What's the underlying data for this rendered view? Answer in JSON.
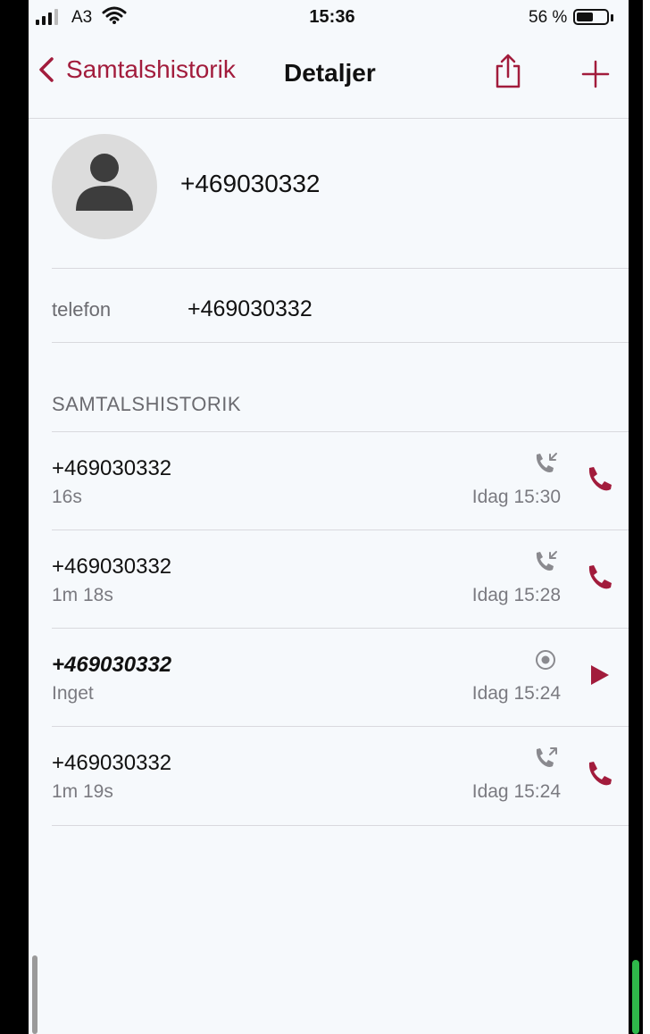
{
  "status_bar": {
    "carrier": "A3",
    "time": "15:36",
    "battery_percent": "56 %",
    "battery_level": 0.56,
    "signal_bars": 3
  },
  "nav": {
    "back_label": "Samtalshistorik",
    "title": "Detaljer",
    "share_icon": "share-icon",
    "add_icon": "plus-icon",
    "accent_color": "#a21c3c"
  },
  "contact": {
    "name": "+469030332",
    "avatar_icon": "person-silhouette-icon"
  },
  "phone_field": {
    "label": "telefon",
    "value": "+469030332"
  },
  "history": {
    "section_title": "SAMTALSHISTORIK",
    "items": [
      {
        "number": "+469030332",
        "duration": "16s",
        "time": "Idag 15:30",
        "type_icon": "incoming-call-icon",
        "action_icon": "phone-icon",
        "emphasized": false
      },
      {
        "number": "+469030332",
        "duration": "1m 18s",
        "time": "Idag 15:28",
        "type_icon": "incoming-call-icon",
        "action_icon": "phone-icon",
        "emphasized": false
      },
      {
        "number": "+469030332",
        "duration": "Inget",
        "time": "Idag 15:24",
        "type_icon": "recording-icon",
        "action_icon": "play-icon",
        "emphasized": true
      },
      {
        "number": "+469030332",
        "duration": "1m 19s",
        "time": "Idag 15:24",
        "type_icon": "outgoing-call-icon",
        "action_icon": "phone-icon",
        "emphasized": false
      }
    ]
  }
}
